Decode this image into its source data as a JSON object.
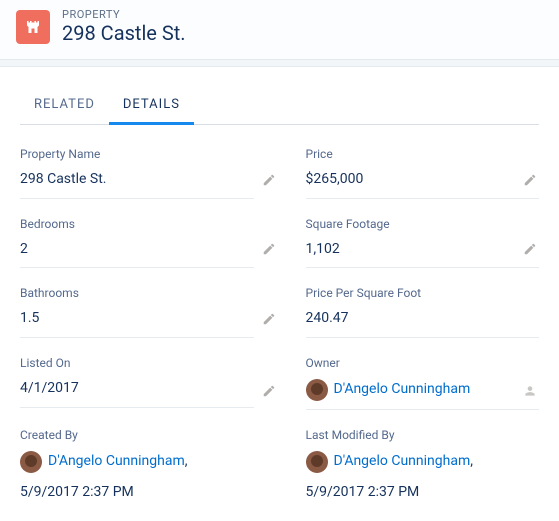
{
  "header": {
    "subtitle": "PROPERTY",
    "title": "298 Castle St."
  },
  "tabs": {
    "related": "RELATED",
    "details": "DETAILS"
  },
  "fields": {
    "property_name": {
      "label": "Property Name",
      "value": "298 Castle St."
    },
    "price": {
      "label": "Price",
      "value": "$265,000"
    },
    "bedrooms": {
      "label": "Bedrooms",
      "value": "2"
    },
    "square_footage": {
      "label": "Square Footage",
      "value": "1,102"
    },
    "bathrooms": {
      "label": "Bathrooms",
      "value": "1.5"
    },
    "ppsf": {
      "label": "Price Per Square Foot",
      "value": "240.47"
    },
    "listed_on": {
      "label": "Listed On",
      "value": "4/1/2017"
    },
    "owner": {
      "label": "Owner",
      "user": "D'Angelo Cunningham"
    },
    "created_by": {
      "label": "Created By",
      "user": "D'Angelo Cunningham",
      "timestamp": "5/9/2017 2:37 PM"
    },
    "last_modified_by": {
      "label": "Last Modified By",
      "user": "D'Angelo Cunningham",
      "timestamp": "5/9/2017 2:37 PM"
    }
  }
}
